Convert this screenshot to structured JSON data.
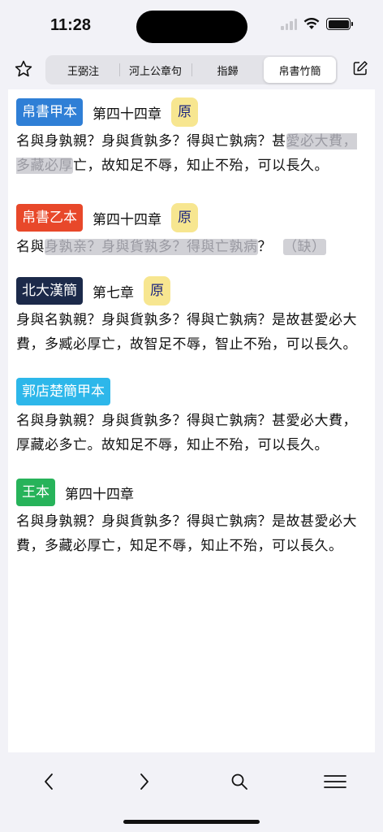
{
  "status": {
    "time": "11:28"
  },
  "toolbar": {
    "segments": [
      {
        "label": "王弼注",
        "active": false
      },
      {
        "label": "河上公章句",
        "active": false
      },
      {
        "label": "指歸",
        "active": false
      },
      {
        "label": "帛書竹簡",
        "active": true
      }
    ]
  },
  "entries": [
    {
      "source": "帛書甲本",
      "color": "#2f7fd6",
      "chapter": "第四十四章",
      "orig": "原",
      "text": [
        {
          "t": "名與身孰親？身與貨孰多？得與亡孰病？甚",
          "g": false
        },
        {
          "t": "愛必大費，多藏必厚",
          "g": true
        },
        {
          "t": "亡，故知足不辱，知止不殆，可以長久。",
          "g": false
        }
      ]
    },
    {
      "source": "帛書乙本",
      "color": "#e8482a",
      "chapter": "第四十四章",
      "orig": "原",
      "text": [
        {
          "t": "名與",
          "g": false
        },
        {
          "t": "身孰亲？身與貨孰多？得與亡孰病",
          "g": true
        },
        {
          "t": "？",
          "g": false
        },
        {
          "t": "（缺）",
          "g": true
        }
      ]
    },
    {
      "source": "北大漢簡",
      "color": "#1c2a4a",
      "chapter": "第七章",
      "orig": "原",
      "text": [
        {
          "t": "身與名孰親？身與貨孰多？得與亡孰病？是故甚愛必大費，多臧必厚亡，故智足不辱，智止不殆，可以長久。",
          "g": false
        }
      ]
    },
    {
      "source": "郭店楚簡甲本",
      "color": "#2db7ea",
      "chapter": "",
      "orig": "",
      "text": [
        {
          "t": "名與身孰親？身與貨孰多？得與亡孰病？甚愛必大費，厚藏必多亡。故知足不辱，知止不殆，可以長久。",
          "g": false
        }
      ]
    },
    {
      "source": "王本",
      "color": "#27b35a",
      "chapter": "第四十四章",
      "orig": "",
      "text": [
        {
          "t": "名與身孰親？身與貨孰多？得與亡孰病？是故甚愛必大費，多藏必厚亡，知足不辱，知止不殆，可以長久。",
          "g": false
        }
      ]
    }
  ],
  "bottom_nav": {
    "icons": [
      "chevron-left-icon",
      "chevron-right-icon",
      "search-icon",
      "menu-icon"
    ]
  },
  "colors": {
    "background": "#f2f2f7",
    "orig_badge": "#f7e690",
    "orig_text": "#1a237e"
  }
}
